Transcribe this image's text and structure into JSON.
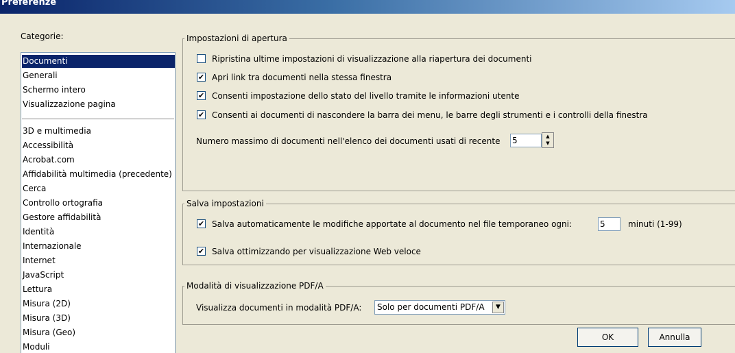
{
  "window": {
    "title": "Preferenze"
  },
  "categories": {
    "label": "Categorie:",
    "label_mnemonic": "g",
    "top_items": [
      {
        "label": "Documenti",
        "selected": true
      },
      {
        "label": "Generali"
      },
      {
        "label": "Schermo intero"
      },
      {
        "label": "Visualizzazione pagina"
      }
    ],
    "items": [
      "3D e multimedia",
      "Accessibilità",
      "Acrobat.com",
      "Affidabilità multimedia (precedente)",
      "Cerca",
      "Controllo ortografia",
      "Gestore affidabilità",
      "Identità",
      "Internazionale",
      "Internet",
      "JavaScript",
      "Lettura",
      "Misura (2D)",
      "Misura (3D)",
      "Misura (Geo)",
      "Moduli"
    ]
  },
  "open_settings": {
    "legend": "Impostazioni di apertura",
    "options": [
      {
        "label": "Ripristina ultime impostazioni di visualizzazione alla riapertura dei documenti",
        "checked": false
      },
      {
        "label": "Apri link tra documenti nella stessa finestra",
        "checked": true
      },
      {
        "label": "Consenti impostazione dello stato del livello tramite le informazioni utente",
        "checked": true
      },
      {
        "label": "Consenti ai documenti di nascondere la barra dei menu, le barre degli strumenti e i controlli della finestra",
        "checked": true
      }
    ],
    "max_recent_label": "Numero massimo di documenti nell'elenco dei documenti usati di recente",
    "max_recent_value": "5"
  },
  "save_settings": {
    "legend": "Salva impostazioni",
    "autosave_label": "Salva automaticamente le modifiche apportate al documento nel file temporaneo ogni:",
    "autosave_checked": true,
    "autosave_value": "5",
    "autosave_unit": "minuti (1-99)",
    "optimize_label": "Salva ottimizzando per visualizzazione Web veloce",
    "optimize_checked": true
  },
  "pdfa": {
    "legend": "Modalità di visualizzazione PDF/A",
    "label": "Visualizza documenti in modalità PDF/A:",
    "selected": "Solo per documenti PDF/A"
  },
  "buttons": {
    "ok": "OK",
    "cancel": "Annulla"
  },
  "icons": {
    "check": "checkmark-icon",
    "spin_up": "up-arrow-icon",
    "spin_down": "down-arrow-icon",
    "dropdown": "chevron-down-icon"
  }
}
